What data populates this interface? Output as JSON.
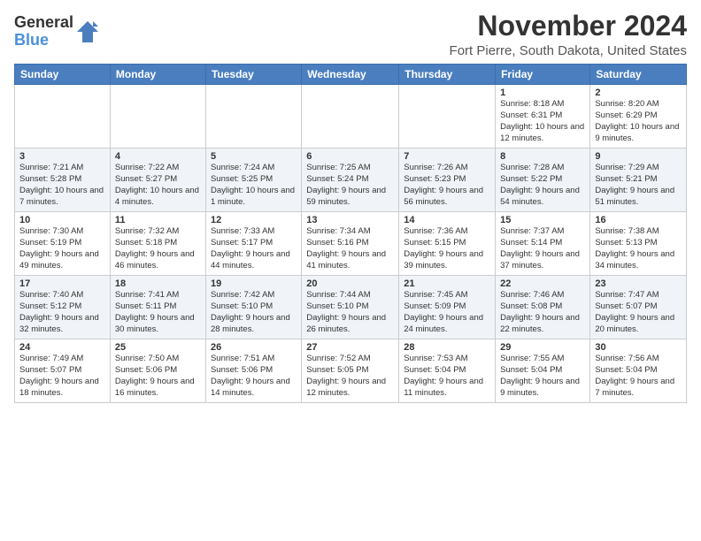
{
  "header": {
    "logo_line1": "General",
    "logo_line2": "Blue",
    "month_title": "November 2024",
    "location": "Fort Pierre, South Dakota, United States"
  },
  "calendar": {
    "headers": [
      "Sunday",
      "Monday",
      "Tuesday",
      "Wednesday",
      "Thursday",
      "Friday",
      "Saturday"
    ],
    "weeks": [
      [
        {
          "day": "",
          "info": ""
        },
        {
          "day": "",
          "info": ""
        },
        {
          "day": "",
          "info": ""
        },
        {
          "day": "",
          "info": ""
        },
        {
          "day": "",
          "info": ""
        },
        {
          "day": "1",
          "info": "Sunrise: 8:18 AM\nSunset: 6:31 PM\nDaylight: 10 hours and 12 minutes."
        },
        {
          "day": "2",
          "info": "Sunrise: 8:20 AM\nSunset: 6:29 PM\nDaylight: 10 hours and 9 minutes."
        }
      ],
      [
        {
          "day": "3",
          "info": "Sunrise: 7:21 AM\nSunset: 5:28 PM\nDaylight: 10 hours and 7 minutes."
        },
        {
          "day": "4",
          "info": "Sunrise: 7:22 AM\nSunset: 5:27 PM\nDaylight: 10 hours and 4 minutes."
        },
        {
          "day": "5",
          "info": "Sunrise: 7:24 AM\nSunset: 5:25 PM\nDaylight: 10 hours and 1 minute."
        },
        {
          "day": "6",
          "info": "Sunrise: 7:25 AM\nSunset: 5:24 PM\nDaylight: 9 hours and 59 minutes."
        },
        {
          "day": "7",
          "info": "Sunrise: 7:26 AM\nSunset: 5:23 PM\nDaylight: 9 hours and 56 minutes."
        },
        {
          "day": "8",
          "info": "Sunrise: 7:28 AM\nSunset: 5:22 PM\nDaylight: 9 hours and 54 minutes."
        },
        {
          "day": "9",
          "info": "Sunrise: 7:29 AM\nSunset: 5:21 PM\nDaylight: 9 hours and 51 minutes."
        }
      ],
      [
        {
          "day": "10",
          "info": "Sunrise: 7:30 AM\nSunset: 5:19 PM\nDaylight: 9 hours and 49 minutes."
        },
        {
          "day": "11",
          "info": "Sunrise: 7:32 AM\nSunset: 5:18 PM\nDaylight: 9 hours and 46 minutes."
        },
        {
          "day": "12",
          "info": "Sunrise: 7:33 AM\nSunset: 5:17 PM\nDaylight: 9 hours and 44 minutes."
        },
        {
          "day": "13",
          "info": "Sunrise: 7:34 AM\nSunset: 5:16 PM\nDaylight: 9 hours and 41 minutes."
        },
        {
          "day": "14",
          "info": "Sunrise: 7:36 AM\nSunset: 5:15 PM\nDaylight: 9 hours and 39 minutes."
        },
        {
          "day": "15",
          "info": "Sunrise: 7:37 AM\nSunset: 5:14 PM\nDaylight: 9 hours and 37 minutes."
        },
        {
          "day": "16",
          "info": "Sunrise: 7:38 AM\nSunset: 5:13 PM\nDaylight: 9 hours and 34 minutes."
        }
      ],
      [
        {
          "day": "17",
          "info": "Sunrise: 7:40 AM\nSunset: 5:12 PM\nDaylight: 9 hours and 32 minutes."
        },
        {
          "day": "18",
          "info": "Sunrise: 7:41 AM\nSunset: 5:11 PM\nDaylight: 9 hours and 30 minutes."
        },
        {
          "day": "19",
          "info": "Sunrise: 7:42 AM\nSunset: 5:10 PM\nDaylight: 9 hours and 28 minutes."
        },
        {
          "day": "20",
          "info": "Sunrise: 7:44 AM\nSunset: 5:10 PM\nDaylight: 9 hours and 26 minutes."
        },
        {
          "day": "21",
          "info": "Sunrise: 7:45 AM\nSunset: 5:09 PM\nDaylight: 9 hours and 24 minutes."
        },
        {
          "day": "22",
          "info": "Sunrise: 7:46 AM\nSunset: 5:08 PM\nDaylight: 9 hours and 22 minutes."
        },
        {
          "day": "23",
          "info": "Sunrise: 7:47 AM\nSunset: 5:07 PM\nDaylight: 9 hours and 20 minutes."
        }
      ],
      [
        {
          "day": "24",
          "info": "Sunrise: 7:49 AM\nSunset: 5:07 PM\nDaylight: 9 hours and 18 minutes."
        },
        {
          "day": "25",
          "info": "Sunrise: 7:50 AM\nSunset: 5:06 PM\nDaylight: 9 hours and 16 minutes."
        },
        {
          "day": "26",
          "info": "Sunrise: 7:51 AM\nSunset: 5:06 PM\nDaylight: 9 hours and 14 minutes."
        },
        {
          "day": "27",
          "info": "Sunrise: 7:52 AM\nSunset: 5:05 PM\nDaylight: 9 hours and 12 minutes."
        },
        {
          "day": "28",
          "info": "Sunrise: 7:53 AM\nSunset: 5:04 PM\nDaylight: 9 hours and 11 minutes."
        },
        {
          "day": "29",
          "info": "Sunrise: 7:55 AM\nSunset: 5:04 PM\nDaylight: 9 hours and 9 minutes."
        },
        {
          "day": "30",
          "info": "Sunrise: 7:56 AM\nSunset: 5:04 PM\nDaylight: 9 hours and 7 minutes."
        }
      ]
    ]
  }
}
